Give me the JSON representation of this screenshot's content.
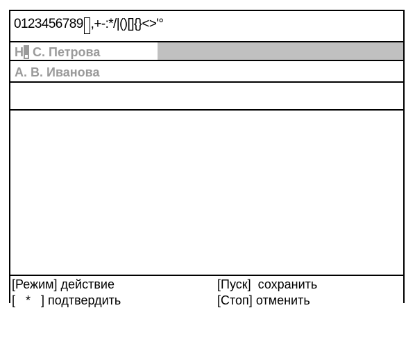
{
  "charset": {
    "before": "0123456789",
    "after": ",+-:*/|()[]{}<>'°"
  },
  "entries": [
    {
      "first_letter": "Н",
      "rest": "С. Петрова"
    },
    {
      "text": "А. В. Иванова"
    },
    {
      "text": ""
    }
  ],
  "footer": {
    "mode_key": "[Режим]",
    "mode_action": "действие",
    "star_key": "[   *   ]",
    "star_action": "подтвердить",
    "start_key": "[Пуск]",
    "start_action": "сохранить",
    "stop_key": "[Стоп]",
    "stop_action": "отменить"
  }
}
